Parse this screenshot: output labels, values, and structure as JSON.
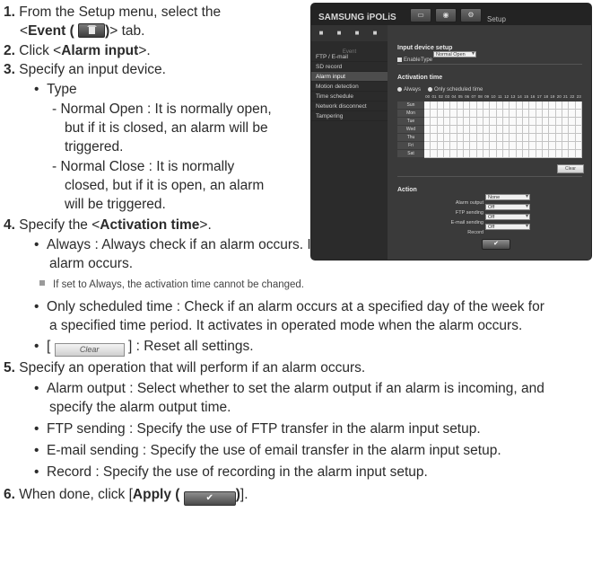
{
  "steps": {
    "s1": {
      "num": "1.",
      "a": "From the Setup menu, select the",
      "b_pre": "<",
      "b_bold": "Event (",
      "b_bold2": ")",
      "b_post": "> tab."
    },
    "s2": {
      "num": "2.",
      "pre": "Click <",
      "bold": "Alarm input",
      "post": ">."
    },
    "s3": {
      "num": "3.",
      "text": "Specify an input device."
    },
    "type": {
      "bullet": "•",
      "label": "Type"
    },
    "normal_open": [
      "- Normal Open : It is normally open,",
      "but if it is closed, an alarm will be",
      "triggered."
    ],
    "normal_close": [
      "- Normal Close : It is normally",
      "closed, but if it is open, an alarm",
      "will be triggered."
    ],
    "s4": {
      "num": "4.",
      "pre": "Specify the <",
      "bold": "Activation time",
      "post": ">."
    },
    "always": [
      "Always : Always check if an alarm occurs. It activates in operated mode when the",
      "alarm occurs."
    ],
    "note": "If set to Always, the activation time cannot be changed.",
    "scheduled": [
      "Only scheduled time : Check if an alarm occurs at a specified day of the week for",
      "a specified time period. It activates in operated mode when the alarm occurs."
    ],
    "clear": {
      "pre": "[",
      "btn": "Clear",
      "post": "] : Reset all settings."
    },
    "s5": {
      "num": "5.",
      "text": "Specify an operation that will perform if an alarm occurs."
    },
    "alarm_output": [
      "Alarm output : Select whether to set the alarm output if an alarm is incoming, and",
      "specify the alarm output time."
    ],
    "ftp": "FTP sending : Specify the use of FTP transfer in the alarm input setup.",
    "email": "E-mail sending : Specify the use of email transfer in the alarm input setup.",
    "record": "Record : Specify the use of recording in the alarm input setup.",
    "s6": {
      "num": "6.",
      "pre": "When done, click [",
      "bold": "Apply (",
      "bold2": ")",
      "post": "]."
    }
  },
  "screenshot": {
    "logo": "SAMSUNG iPOLiS",
    "setup": "Setup",
    "event_label": "Event",
    "menu": [
      "FTP / E-mail",
      "SD record",
      "Alarm input",
      "Motion detection",
      "Time schedule",
      "Network disconnect",
      "Tampering"
    ],
    "selected_menu": "Alarm input",
    "input_header": "Input device setup",
    "enable": "Enable",
    "type_label": "Type",
    "type_value": "Normal Open",
    "activation_header": "Activation time",
    "always": "Always",
    "only_scheduled": "Only scheduled time",
    "hours": [
      "00",
      "01",
      "02",
      "03",
      "04",
      "05",
      "06",
      "07",
      "08",
      "09",
      "10",
      "11",
      "12",
      "13",
      "14",
      "15",
      "16",
      "17",
      "18",
      "19",
      "20",
      "21",
      "22",
      "23"
    ],
    "days": [
      "Sun",
      "Mon",
      "Tue",
      "Wed",
      "Thu",
      "Fri",
      "Sat"
    ],
    "clear_btn": "Clear",
    "action_header": "Action",
    "actions": [
      {
        "label": "Alarm output",
        "value": "None"
      },
      {
        "label": "FTP sending",
        "value": "Off"
      },
      {
        "label": "E-mail sending",
        "value": "Off"
      },
      {
        "label": "Record",
        "value": "Off"
      }
    ],
    "apply": "✔"
  },
  "icons": {
    "event": "event-icon",
    "clear": "clear-button-icon",
    "apply": "apply-check-icon"
  },
  "colors": {
    "panel_bg": "#3a3a3a",
    "text": "#2b2b2b"
  }
}
